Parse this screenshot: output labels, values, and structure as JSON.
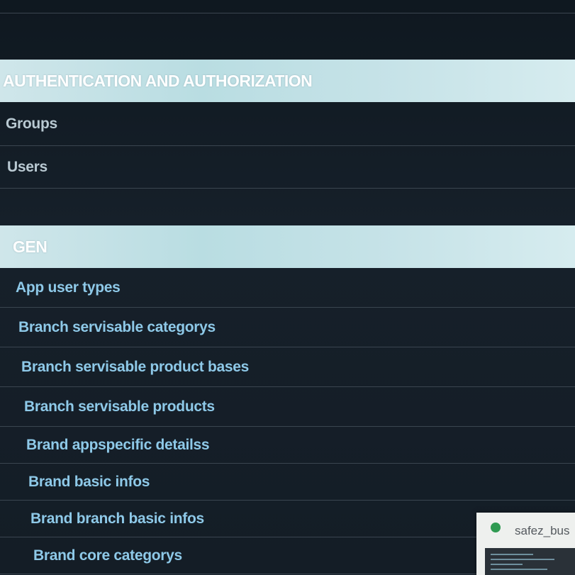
{
  "admin": {
    "modules": [
      {
        "name": "AUTHENTICATION AND AUTHORIZATION",
        "models": [
          "Groups",
          "Users"
        ]
      },
      {
        "name": "GEN",
        "models": [
          "App user types",
          "Branch servisable categorys",
          "Branch servisable product bases",
          "Branch servisable products",
          "Brand appspecific detailss",
          "Brand basic infos",
          "Brand branch basic infos",
          "Brand core categorys"
        ]
      }
    ]
  },
  "taskbar_preview": {
    "title": "safez_bus",
    "icon": "app-icon"
  },
  "colors": {
    "background": "#121c24",
    "header_bg": "#c7e3e8",
    "link": "#8ec9e8",
    "divider": "#3a4550"
  }
}
